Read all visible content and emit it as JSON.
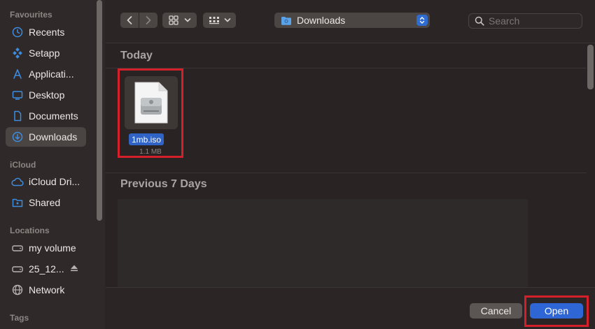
{
  "sidebar": {
    "favourites_title": "Favourites",
    "favourites": [
      {
        "label": "Recents",
        "icon": "clock-icon"
      },
      {
        "label": "Setapp",
        "icon": "setapp-icon"
      },
      {
        "label": "Applicati...",
        "icon": "applications-icon"
      },
      {
        "label": "Desktop",
        "icon": "desktop-icon"
      },
      {
        "label": "Documents",
        "icon": "document-icon"
      },
      {
        "label": "Downloads",
        "icon": "downloads-icon",
        "selected": true
      }
    ],
    "icloud_title": "iCloud",
    "icloud": [
      {
        "label": "iCloud Dri...",
        "icon": "cloud-icon"
      },
      {
        "label": "Shared",
        "icon": "shared-folder-icon"
      }
    ],
    "locations_title": "Locations",
    "locations": [
      {
        "label": "my volume",
        "icon": "drive-icon"
      },
      {
        "label": "25_12...",
        "icon": "drive-icon",
        "ejectable": true
      },
      {
        "label": "Network",
        "icon": "globe-icon"
      }
    ],
    "tags_title": "Tags"
  },
  "toolbar": {
    "location": "Downloads",
    "search_placeholder": "Search"
  },
  "groups": {
    "today": "Today",
    "previous": "Previous 7 Days"
  },
  "files": [
    {
      "name": "1mb.iso",
      "size": "1.1 MB",
      "icon": "disk-image-icon"
    }
  ],
  "buttons": {
    "cancel": "Cancel",
    "open": "Open"
  },
  "colors": {
    "accent": "#2f66d6",
    "highlight": "#d4202a",
    "sidebar_icon": "#3d8ce0"
  }
}
